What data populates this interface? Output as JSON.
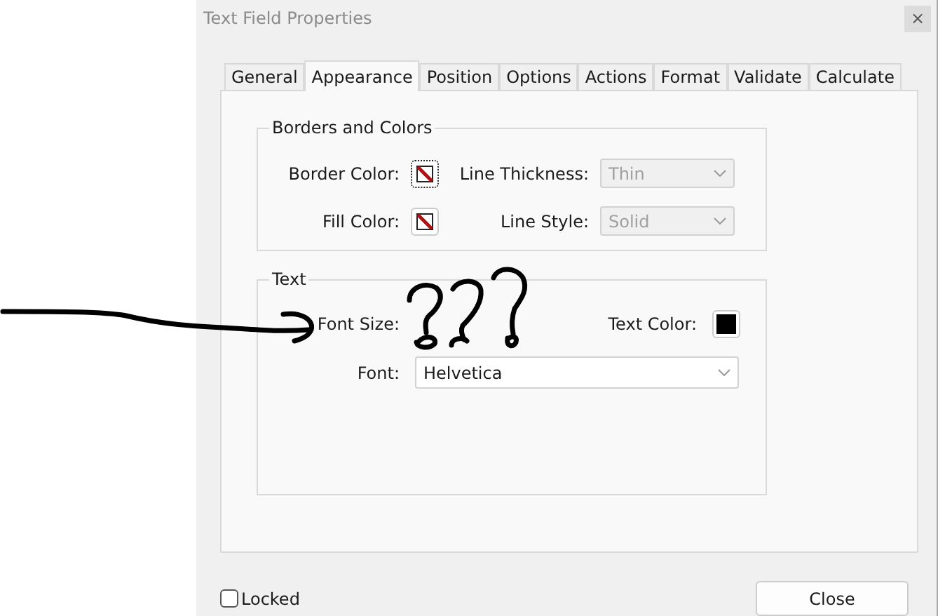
{
  "window": {
    "title": "Text Field Properties",
    "close_glyph": "×"
  },
  "tabs": [
    {
      "label": "General",
      "selected": false
    },
    {
      "label": "Appearance",
      "selected": true
    },
    {
      "label": "Position",
      "selected": false
    },
    {
      "label": "Options",
      "selected": false
    },
    {
      "label": "Actions",
      "selected": false
    },
    {
      "label": "Format",
      "selected": false
    },
    {
      "label": "Validate",
      "selected": false
    },
    {
      "label": "Calculate",
      "selected": false
    }
  ],
  "borders_and_colors": {
    "title": "Borders and Colors",
    "border_color": {
      "label": "Border Color:",
      "transparent": true,
      "focused": true
    },
    "fill_color": {
      "label": "Fill Color:",
      "transparent": true,
      "focused": false
    },
    "line_thickness": {
      "label": "Line Thickness:",
      "value": "Thin",
      "disabled": true
    },
    "line_style": {
      "label": "Line Style:",
      "value": "Solid",
      "disabled": true
    }
  },
  "text": {
    "title": "Text",
    "font_size": {
      "label": "Font Size:"
    },
    "text_color": {
      "label": "Text Color:",
      "color": "#000000"
    },
    "font": {
      "label": "Font:",
      "value": "Helvetica",
      "disabled": false
    }
  },
  "locked": {
    "label": "Locked",
    "checked": false
  },
  "buttons": [
    {
      "label": "Close"
    }
  ]
}
